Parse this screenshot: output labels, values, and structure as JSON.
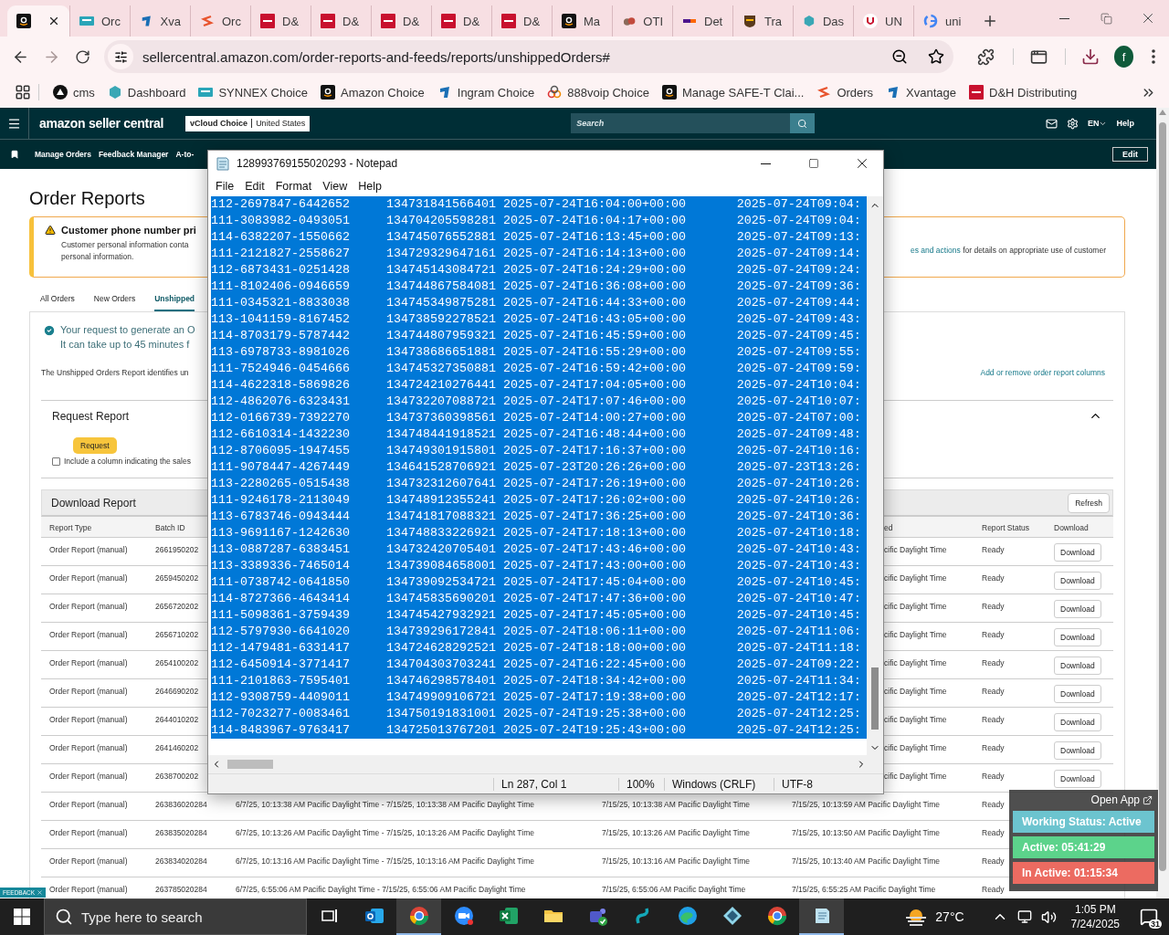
{
  "browser": {
    "tabs": [
      {
        "kind": "amazon",
        "selected": true
      },
      {
        "kind": "synnex",
        "title": "Orc",
        "selected": false
      },
      {
        "kind": "ingram",
        "title": "Xva",
        "selected": false
      },
      {
        "kind": "scale",
        "title": "Orc",
        "selected": false
      },
      {
        "kind": "dh",
        "title": "D&",
        "selected": false
      },
      {
        "kind": "dh",
        "title": "D&",
        "selected": false
      },
      {
        "kind": "dh",
        "title": "D&",
        "selected": false
      },
      {
        "kind": "dh",
        "title": "D&",
        "selected": false
      },
      {
        "kind": "dh",
        "title": "D&",
        "selected": false
      },
      {
        "kind": "amazon",
        "title": "Ma",
        "selected": false
      },
      {
        "kind": "otl",
        "title": "OTI",
        "selected": false
      },
      {
        "kind": "fedex",
        "title": "Det",
        "selected": false
      },
      {
        "kind": "ups",
        "title": "Tra",
        "selected": false
      },
      {
        "kind": "hexagon",
        "title": "Das",
        "selected": false
      },
      {
        "kind": "u",
        "title": "UN",
        "selected": false
      },
      {
        "kind": "google",
        "title": "uni",
        "selected": false
      }
    ],
    "forward_disabled": true,
    "url": "sellercentral.amazon.com/order-reports-and-feeds/reports/unshippedOrders#",
    "avatar": "f",
    "bookmarks": [
      {
        "kind": "cms",
        "label": "cms"
      },
      {
        "kind": "hexagon",
        "label": "Dashboard"
      },
      {
        "kind": "synnex",
        "label": "SYNNEX Choice"
      },
      {
        "kind": "amazon",
        "label": "Amazon Choice"
      },
      {
        "kind": "ingram",
        "label": "Ingram Choice"
      },
      {
        "kind": "voip",
        "label": "888voip Choice"
      },
      {
        "kind": "amazon",
        "label": "Manage SAFE-T Clai..."
      },
      {
        "kind": "scale",
        "label": "Orders"
      },
      {
        "kind": "ingram",
        "label": "Xvantage"
      },
      {
        "kind": "dh",
        "label": "D&H Distributing"
      }
    ]
  },
  "seller_central": {
    "logo": "amazon seller central",
    "account": "vCloud Choice",
    "marketplace": "United States",
    "search": {
      "placeholder": "Search"
    },
    "language": "EN",
    "help": "Help",
    "nav": [
      "Manage Orders",
      "Feedback Manager",
      "A-to-"
    ],
    "edit": "Edit",
    "title": "Order Reports",
    "alert": {
      "title": "Customer phone number pri",
      "body": "Customer personal information conta",
      "body_2": "personal information.",
      "right_text": "**es and actions** for details on appropriate use of customer"
    },
    "tabs": [
      {
        "label": "All Orders",
        "selected": false
      },
      {
        "label": "New Orders",
        "selected": false
      },
      {
        "label": "Unshipped",
        "selected": true
      }
    ],
    "success": [
      "Your request to generate an O",
      "It can take up to 45 minutes f"
    ],
    "description": "The Unshipped Orders Report identifies un",
    "columns_link": "Add or remove order report columns",
    "request_report": {
      "title": "Request Report",
      "expanded": true,
      "button": "Request",
      "checkbox": {
        "label": "Include a column indicating the sales",
        "checked": false
      }
    },
    "download_report": {
      "title": "Download Report",
      "refresh": "Refresh",
      "columns": [
        {
          "label": "Report Type"
        },
        {
          "label": "Batch ID"
        },
        {},
        {},
        {
          "label": "ed"
        },
        {
          "label": "Report Status"
        },
        {
          "label": "Download"
        }
      ],
      "rows": [
        {
          "report_type": "Order Report (manual)",
          "batch_id": "2661950202",
          "column_5": "cific Daylight Time",
          "report_status": "Ready",
          "download": "Download"
        },
        {
          "report_type": "Order Report (manual)",
          "batch_id": "2659450202",
          "column_5": "cific Daylight Time",
          "report_status": "Ready",
          "download": "Download"
        },
        {
          "report_type": "Order Report (manual)",
          "batch_id": "2656720202",
          "column_5": "cific Daylight Time",
          "report_status": "Ready",
          "download": "Download"
        },
        {
          "report_type": "Order Report (manual)",
          "batch_id": "2656710202",
          "column_5": "cific Daylight Time",
          "report_status": "Ready",
          "download": "Download"
        },
        {
          "report_type": "Order Report (manual)",
          "batch_id": "2654100202",
          "column_5": "cific Daylight Time",
          "report_status": "Ready",
          "download": "Download"
        },
        {
          "report_type": "Order Report (manual)",
          "batch_id": "2646690202",
          "column_5": "cific Daylight Time",
          "report_status": "Ready",
          "download": "Download"
        },
        {
          "report_type": "Order Report (manual)",
          "batch_id": "2644010202",
          "column_5": "cific Daylight Time",
          "report_status": "Ready",
          "download": "Download"
        },
        {
          "report_type": "Order Report (manual)",
          "batch_id": "2641460202",
          "column_5": "cific Daylight Time",
          "report_status": "Ready",
          "download": "Download"
        },
        {
          "report_type": "Order Report (manual)",
          "batch_id": "2638700202",
          "column_5": "cific Daylight Time",
          "report_status": "Ready",
          "download": "Download"
        },
        {
          "report_type": "Order Report (manual)",
          "batch_id": "263836020284",
          "column_3": "6/7/25, 10:13:38 AM Pacific Daylight Time - 7/15/25, 10:13:38 AM Pacific Daylight Time",
          "column_4": "7/15/25, 10:13:38 AM Pacific Daylight Time",
          "column_5": "7/15/25, 10:13:59 AM Pacific Daylight Time",
          "report_status": "Ready"
        },
        {
          "report_type": "Order Report (manual)",
          "batch_id": "263835020284",
          "column_3": "6/7/25, 10:13:26 AM Pacific Daylight Time - 7/15/25, 10:13:26 AM Pacific Daylight Time",
          "column_4": "7/15/25, 10:13:26 AM Pacific Daylight Time",
          "column_5": "7/15/25, 10:13:50 AM Pacific Daylight Time",
          "report_status": "Ready"
        },
        {
          "report_type": "Order Report (manual)",
          "batch_id": "263834020284",
          "column_3": "6/7/25, 10:13:16 AM Pacific Daylight Time - 7/15/25, 10:13:16 AM Pacific Daylight Time",
          "column_4": "7/15/25, 10:13:16 AM Pacific Daylight Time",
          "column_5": "7/15/25, 10:13:40 AM Pacific Daylight Time",
          "report_status": "Ready"
        },
        {
          "report_type": "Order Report (manual)",
          "batch_id": "263785020284",
          "column_3": "6/7/25, 6:55:06 AM Pacific Daylight Time - 7/15/25, 6:55:06 AM Pacific Daylight Time",
          "column_4": "7/15/25, 6:55:06 AM Pacific Daylight Time",
          "column_5": "7/15/25, 6:55:25 AM Pacific Daylight Time",
          "report_status": "Ready"
        }
      ]
    },
    "feedback": "FEEDBACK"
  },
  "notepad": {
    "title": "128993769155020293 - Notepad",
    "menu": [
      "File",
      "Edit",
      "Format",
      "View",
      "Help"
    ],
    "lines": [
      {
        "text": "112-2697847-6442652     134731841566401 2025-07-24T16:04:00+00:00       2025-07-24T09:04:",
        "selected": true
      },
      {
        "text": "111-3083982-0493051     134704205598281 2025-07-24T16:04:17+00:00       2025-07-24T09:04:",
        "selected": true
      },
      {
        "text": "114-6382207-1550662     134745076552881 2025-07-24T16:13:45+00:00       2025-07-24T09:13:",
        "selected": true
      },
      {
        "text": "111-2121827-2558627     134729329647161 2025-07-24T16:14:13+00:00       2025-07-24T09:14:",
        "selected": true
      },
      {
        "text": "112-6873431-0251428     134745143084721 2025-07-24T16:24:29+00:00       2025-07-24T09:24:",
        "selected": true
      },
      {
        "text": "111-8102406-0946659     134744867584081 2025-07-24T16:36:08+00:00       2025-07-24T09:36:",
        "selected": true
      },
      {
        "text": "111-0345321-8833038     134745349875281 2025-07-24T16:44:33+00:00       2025-07-24T09:44:",
        "selected": true
      },
      {
        "text": "113-1041159-8167452     134738592278521 2025-07-24T16:43:05+00:00       2025-07-24T09:43:",
        "selected": true
      },
      {
        "text": "114-8703179-5787442     134744807959321 2025-07-24T16:45:59+00:00       2025-07-24T09:45:",
        "selected": true
      },
      {
        "text": "113-6978733-8981026     134738686651881 2025-07-24T16:55:29+00:00       2025-07-24T09:55:",
        "selected": true
      },
      {
        "text": "111-7524946-0454666     134745327350881 2025-07-24T16:59:42+00:00       2025-07-24T09:59:",
        "selected": true
      },
      {
        "text": "114-4622318-5869826     134724210276441 2025-07-24T17:04:05+00:00       2025-07-24T10:04:",
        "selected": true
      },
      {
        "text": "112-4862076-6323431     134732207088721 2025-07-24T17:07:46+00:00       2025-07-24T10:07:",
        "selected": true
      },
      {
        "text": "112-0166739-7392270     134737360398561 2025-07-24T14:00:27+00:00       2025-07-24T07:00:",
        "selected": true
      },
      {
        "text": "112-6610314-1432230     134748441918521 2025-07-24T16:48:44+00:00       2025-07-24T09:48:",
        "selected": true
      },
      {
        "text": "112-8706095-1947455     134749301915801 2025-07-24T17:16:37+00:00       2025-07-24T10:16:",
        "selected": true
      },
      {
        "text": "111-9078447-4267449     134641528706921 2025-07-23T20:26:26+00:00       2025-07-23T13:26:",
        "selected": true
      },
      {
        "text": "113-2280265-0515438     134732312607641 2025-07-24T17:26:19+00:00       2025-07-24T10:26:",
        "selected": true
      },
      {
        "text": "111-9246178-2113049     134748912355241 2025-07-24T17:26:02+00:00       2025-07-24T10:26:",
        "selected": true
      },
      {
        "text": "113-6783746-0943444     134741817088321 2025-07-24T17:36:25+00:00       2025-07-24T10:36:",
        "selected": true
      },
      {
        "text": "113-9691167-1242630     134748833226921 2025-07-24T17:18:13+00:00       2025-07-24T10:18:",
        "selected": true
      },
      {
        "text": "113-0887287-6383451     134732420705401 2025-07-24T17:43:46+00:00       2025-07-24T10:43:",
        "selected": true
      },
      {
        "text": "113-3389336-7465014     134739084658001 2025-07-24T17:43:00+00:00       2025-07-24T10:43:",
        "selected": true
      },
      {
        "text": "111-0738742-0641850     134739092534721 2025-07-24T17:45:04+00:00       2025-07-24T10:45:",
        "selected": true
      },
      {
        "text": "114-8727366-4643414     134745835690201 2025-07-24T17:47:36+00:00       2025-07-24T10:47:",
        "selected": true
      },
      {
        "text": "111-5098361-3759439     134745427932921 2025-07-24T17:45:05+00:00       2025-07-24T10:45:",
        "selected": true
      },
      {
        "text": "112-5797930-6641020     134739296172841 2025-07-24T18:06:11+00:00       2025-07-24T11:06:",
        "selected": true
      },
      {
        "text": "112-1479481-6331417     134724628292521 2025-07-24T18:18:00+00:00       2025-07-24T11:18:",
        "selected": true
      },
      {
        "text": "112-6450914-3771417     134704303703241 2025-07-24T16:22:45+00:00       2025-07-24T09:22:",
        "selected": true
      },
      {
        "text": "111-2101863-7595401     134746298578401 2025-07-24T18:34:42+00:00       2025-07-24T11:34:",
        "selected": true
      },
      {
        "text": "112-9308759-4409011     134749909106721 2025-07-24T17:19:38+00:00       2025-07-24T12:17:",
        "selected": true
      },
      {
        "text": "112-7023277-0083461     134750191831001 2025-07-24T19:25:38+00:00       2025-07-24T12:25:",
        "selected": true
      },
      {
        "text": "114-8483967-9763417     134725013767201 2025-07-24T19:25:43+00:00       2025-07-24T12:25:",
        "selected": true
      }
    ],
    "status": [
      "Ln 287, Col 1",
      "100%",
      "Windows (CRLF)",
      "UTF-8"
    ]
  },
  "work_widget": {
    "open_app": "Open App",
    "statuses": [
      {
        "label": "Working Status: Active",
        "color": "#6cc4cf"
      },
      {
        "label": "Active: 05:41:29",
        "color": "#5cd38b"
      },
      {
        "label": "In Active: 01:15:34",
        "color": "#ec6b61"
      }
    ]
  },
  "taskbar": {
    "search": {
      "placeholder": "Type here to search"
    },
    "apps": [
      {
        "kind": "taskview",
        "selected": false
      },
      {
        "kind": "outlook",
        "selected": false
      },
      {
        "kind": "chrome",
        "selected": true
      },
      {
        "kind": "zoom",
        "selected": false
      },
      {
        "kind": "excel",
        "selected": false
      },
      {
        "kind": "explorer",
        "selected": false
      },
      {
        "kind": "teams",
        "selected": false
      },
      {
        "kind": "sway",
        "selected": false
      },
      {
        "kind": "edge",
        "selected": false
      },
      {
        "kind": "hexapp",
        "selected": false
      },
      {
        "kind": "chrome",
        "selected": false
      },
      {
        "kind": "notepad",
        "selected": true
      }
    ],
    "temperature": "27°C",
    "time": "1:05 PM",
    "date": "7/24/2025",
    "notifications": "31"
  }
}
